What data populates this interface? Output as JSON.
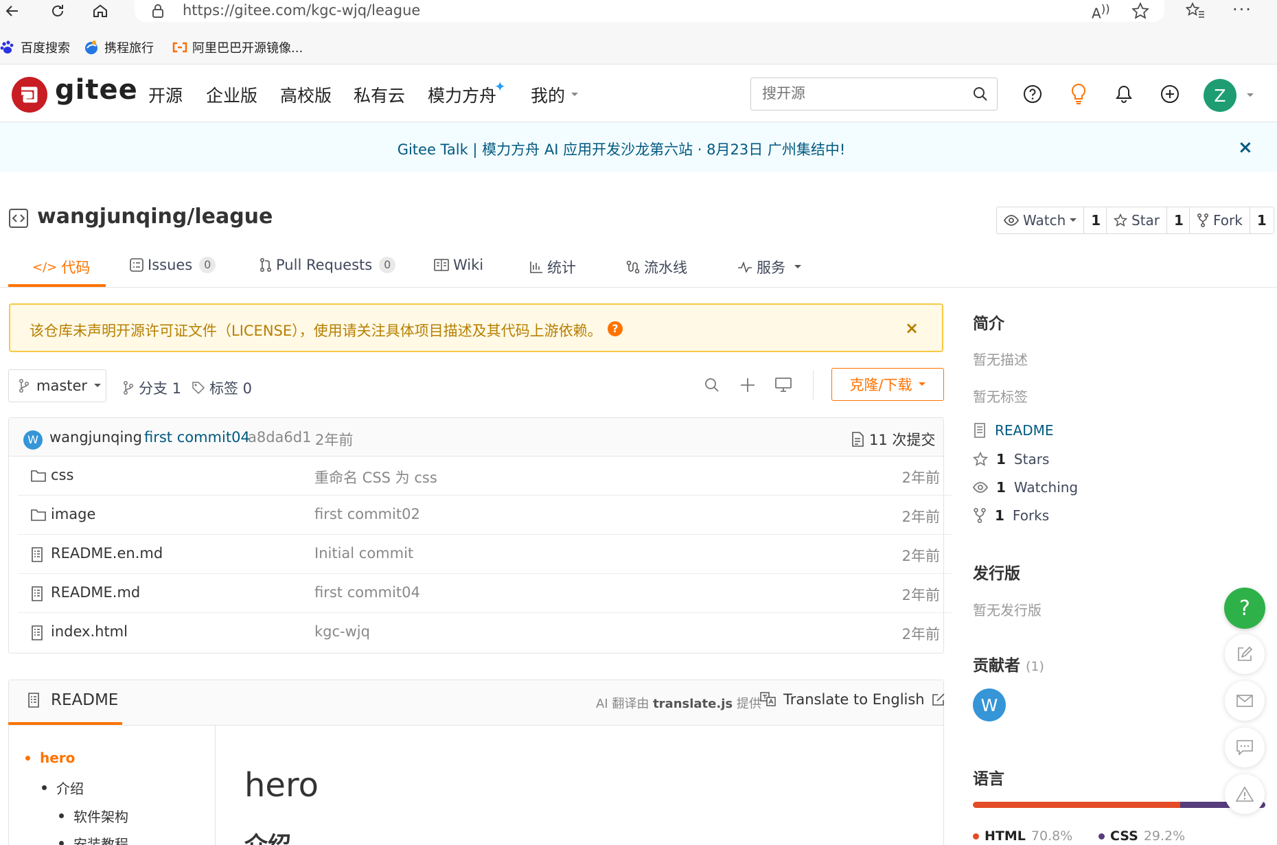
{
  "browser": {
    "url": "https://gitee.com/kgc-wjq/league",
    "bookmarks": [
      "百度搜索",
      "携程旅行",
      "阿里巴巴开源镜像..."
    ]
  },
  "header": {
    "logo_text": "gitee",
    "nav": [
      "开源",
      "企业版",
      "高校版",
      "私有云",
      "模力方舟",
      "我的"
    ],
    "search_placeholder": "搜开源",
    "avatar_letter": "Z"
  },
  "announcement": {
    "text": "Gitee Talk | 模力方舟 AI 应用开发沙龙第六站 · 8月23日 广州集结中!",
    "close": "×"
  },
  "project": {
    "title": "wangjunqing/league",
    "watch_label": "Watch",
    "watch_count": "1",
    "star_label": "Star",
    "star_count": "1",
    "fork_label": "Fork",
    "fork_count": "1"
  },
  "tabs": {
    "code": "代码",
    "issues": "Issues",
    "issues_count": "0",
    "pulls": "Pull Requests",
    "pulls_count": "0",
    "wiki": "Wiki",
    "stats": "统计",
    "pipeline": "流水线",
    "services": "服务"
  },
  "license_notice": {
    "text": "该仓库未声明开源许可证文件（LICENSE），使用请关注具体项目描述及其代码上游依赖。",
    "help": "?",
    "close": "×"
  },
  "branch_bar": {
    "branch": "master",
    "branches_label": "分支 1",
    "tags_label": "标签 0",
    "clone_label": "克隆/下载"
  },
  "last_commit": {
    "avatar_letter": "W",
    "author": "wangjunqing",
    "message": "first commit04",
    "hash": "a8da6d1",
    "time": "2年前",
    "commit_count": "11 次提交"
  },
  "files": [
    {
      "name": "css",
      "type": "folder",
      "message": "重命名 CSS 为 css",
      "time": "2年前"
    },
    {
      "name": "image",
      "type": "folder",
      "message": "first commit02",
      "time": "2年前"
    },
    {
      "name": "README.en.md",
      "type": "file",
      "message": "Initial commit",
      "time": "2年前"
    },
    {
      "name": "README.md",
      "type": "file",
      "message": "first commit04",
      "time": "2年前"
    },
    {
      "name": "index.html",
      "type": "file",
      "message": "kgc-wjq",
      "time": "2年前"
    }
  ],
  "readme": {
    "tab_label": "README",
    "ai_note_prefix": "AI 翻译由",
    "ai_note_lib": "translate.js",
    "ai_note_suffix": "提供",
    "translate_label": "Translate to English",
    "toc": [
      "hero",
      "介绍",
      "软件架构",
      "安装教程"
    ],
    "h1": "hero",
    "h2": "介绍"
  },
  "sidebar": {
    "intro_title": "简介",
    "no_desc": "暂无描述",
    "no_tags": "暂无标签",
    "readme_link": "README",
    "stars_count": "1",
    "stars_label": "Stars",
    "watching_count": "1",
    "watching_label": "Watching",
    "forks_count": "1",
    "forks_label": "Forks",
    "release_title": "发行版",
    "no_release": "暂无发行版",
    "contributors_title": "贡献者",
    "contributors_count": "(1)",
    "contributor_letter": "W",
    "languages_title": "语言",
    "languages": [
      {
        "name": "HTML",
        "percent": 70.8,
        "percent_label": "70.8%",
        "color": "#e34c26"
      },
      {
        "name": "CSS",
        "percent": 29.2,
        "percent_label": "29.2%",
        "color": "#563d7c"
      }
    ]
  },
  "fab": {
    "help": "?"
  },
  "colors": {
    "accent": "#fe7300",
    "brand": "#c71d23",
    "help_green": "#2fb14a"
  }
}
